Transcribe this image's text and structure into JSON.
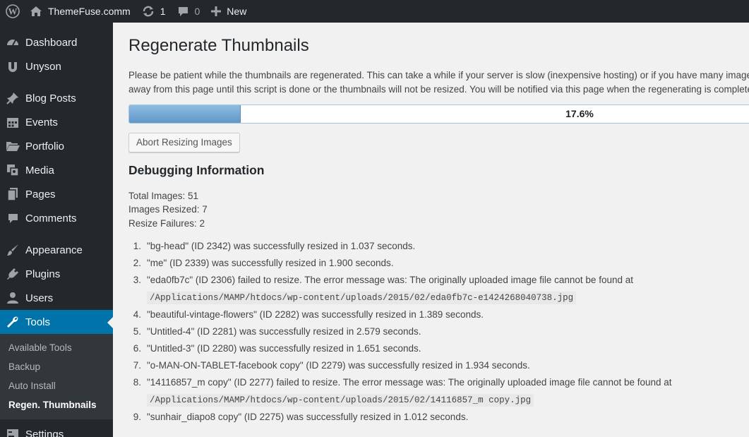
{
  "adminbar": {
    "site_name": "ThemeFuse.comm",
    "updates_count": "1",
    "comments_count": "0",
    "new_label": "New"
  },
  "sidebar": {
    "items": [
      {
        "label": "Dashboard",
        "icon": "dashboard-icon"
      },
      {
        "label": "Unyson",
        "icon": "unyson-icon"
      },
      {
        "label": "Blog Posts",
        "icon": "pin-icon"
      },
      {
        "label": "Events",
        "icon": "calendar-icon"
      },
      {
        "label": "Portfolio",
        "icon": "folder-icon"
      },
      {
        "label": "Media",
        "icon": "media-icon"
      },
      {
        "label": "Pages",
        "icon": "pages-icon"
      },
      {
        "label": "Comments",
        "icon": "comment-icon"
      },
      {
        "label": "Appearance",
        "icon": "brush-icon"
      },
      {
        "label": "Plugins",
        "icon": "plug-icon"
      },
      {
        "label": "Users",
        "icon": "user-icon"
      },
      {
        "label": "Tools",
        "icon": "wrench-icon"
      },
      {
        "label": "Settings",
        "icon": "settings-icon"
      }
    ],
    "submenu": [
      "Available Tools",
      "Backup",
      "Auto Install",
      "Regen. Thumbnails"
    ]
  },
  "main": {
    "title": "Regenerate Thumbnails",
    "intro": "Please be patient while the thumbnails are regenerated. This can take a while if your server is slow (inexpensive hosting) or if you have many images. Do not navigate away from this page until this script is done or the thumbnails will not be resized. You will be notified via this page when the regenerating is completed.",
    "progress_label": "17.6%",
    "progress_value": 0.176,
    "abort_label": "Abort Resizing Images",
    "debug_title": "Debugging Information",
    "stats": {
      "total": "Total Images: 51",
      "resized": "Images Resized: 7",
      "failures": "Resize Failures: 2"
    },
    "log": [
      {
        "num": "1.",
        "text": "\"bg-head\" (ID 2342) was successfully resized in 1.037 seconds."
      },
      {
        "num": "2.",
        "text": "\"me\" (ID 2339) was successfully resized in 1.900 seconds."
      },
      {
        "num": "3.",
        "text": "\"eda0fb7c\" (ID 2306) failed to resize. The error message was: The originally uploaded image file cannot be found at ",
        "code": "/Applications/MAMP/htdocs/wp-content/uploads/2015/02/eda0fb7c-e1424268040738.jpg"
      },
      {
        "num": "4.",
        "text": "\"beautiful-vintage-flowers\" (ID 2282) was successfully resized in 1.389 seconds."
      },
      {
        "num": "5.",
        "text": "\"Untitled-4\" (ID 2281) was successfully resized in 2.579 seconds."
      },
      {
        "num": "6.",
        "text": "\"Untitled-3\" (ID 2280) was successfully resized in 1.651 seconds."
      },
      {
        "num": "7.",
        "text": "\"o-MAN-ON-TABLET-facebook copy\" (ID 2279) was successfully resized in 1.934 seconds."
      },
      {
        "num": "8.",
        "text": "\"14116857_m copy\" (ID 2277) failed to resize. The error message was: The originally uploaded image file cannot be found at ",
        "code": "/Applications/MAMP/htdocs/wp-content/uploads/2015/02/14116857_m copy.jpg"
      },
      {
        "num": "9.",
        "text": "\"sunhair_diapo8 copy\" (ID 2275) was successfully resized in 1.012 seconds."
      }
    ]
  },
  "colors": {
    "sidebar_bg": "#23282d",
    "accent": "#0073aa",
    "progress_fill": "#6fa3d3"
  }
}
